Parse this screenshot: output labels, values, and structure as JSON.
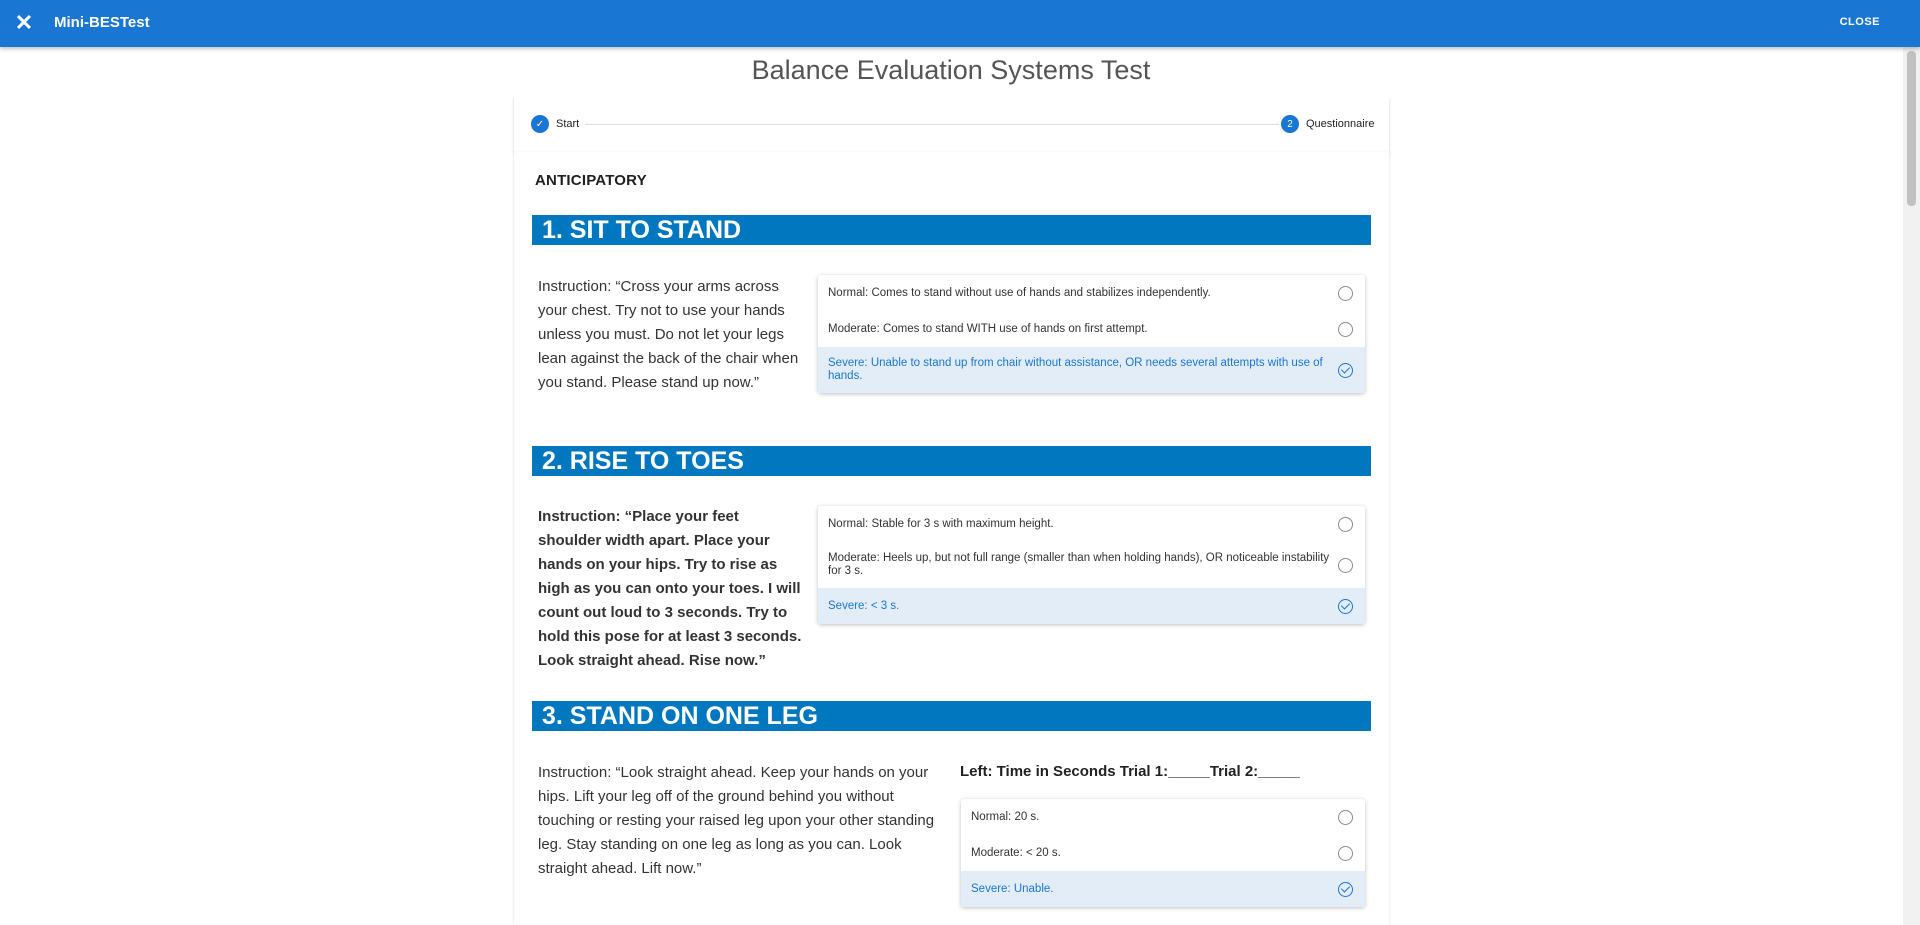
{
  "appbar": {
    "title": "Mini-BESTest",
    "close_label": "CLOSE"
  },
  "page_title": "Balance Evaluation Systems Test",
  "stepper": {
    "steps": [
      {
        "label": "Start",
        "num": ""
      },
      {
        "label": "Questionnaire",
        "num": "2"
      }
    ]
  },
  "category": "ANTICIPATORY",
  "sections": [
    {
      "title": "1. SIT TO STAND",
      "instruction": "Instruction: “Cross your arms across your chest. Try not to use your hands unless you must. Do not let your legs lean against the back of the chair when you stand. Please stand up now.”",
      "options": [
        "Normal: Comes to stand without use of hands and stabilizes independently.",
        "Moderate: Comes to stand WITH use of hands on first attempt.",
        "Severe: Unable to stand up from chair without assistance, OR needs several attempts with use of hands."
      ],
      "selected": 2
    },
    {
      "title": "2. RISE TO TOES",
      "instruction": "Instruction: “Place your feet shoulder width apart. Place your hands on your hips. Try to rise as high as you can onto your toes. I will count out loud to 3 seconds. Try to hold this pose for at least 3 seconds. Look straight ahead. Rise now.”",
      "options": [
        "Normal: Stable for 3 s with maximum height.",
        "Moderate: Heels up, but not full range (smaller than when holding hands), OR noticeable instability for 3 s.",
        "Severe: < 3 s."
      ],
      "selected": 2
    },
    {
      "title": "3. STAND ON ONE LEG",
      "instruction": "Instruction: “Look straight ahead. Keep your hands on your hips. Lift your leg off of the ground behind you without touching or resting your raised leg upon your other standing leg. Stay standing on one leg as long as you can. Look straight ahead. Lift now.”",
      "trial_label": "Left: Time in Seconds Trial 1:_____Trial 2:_____",
      "options": [
        "Normal: 20 s.",
        "Moderate: < 20 s.",
        "Severe: Unable."
      ],
      "selected": 2
    }
  ]
}
